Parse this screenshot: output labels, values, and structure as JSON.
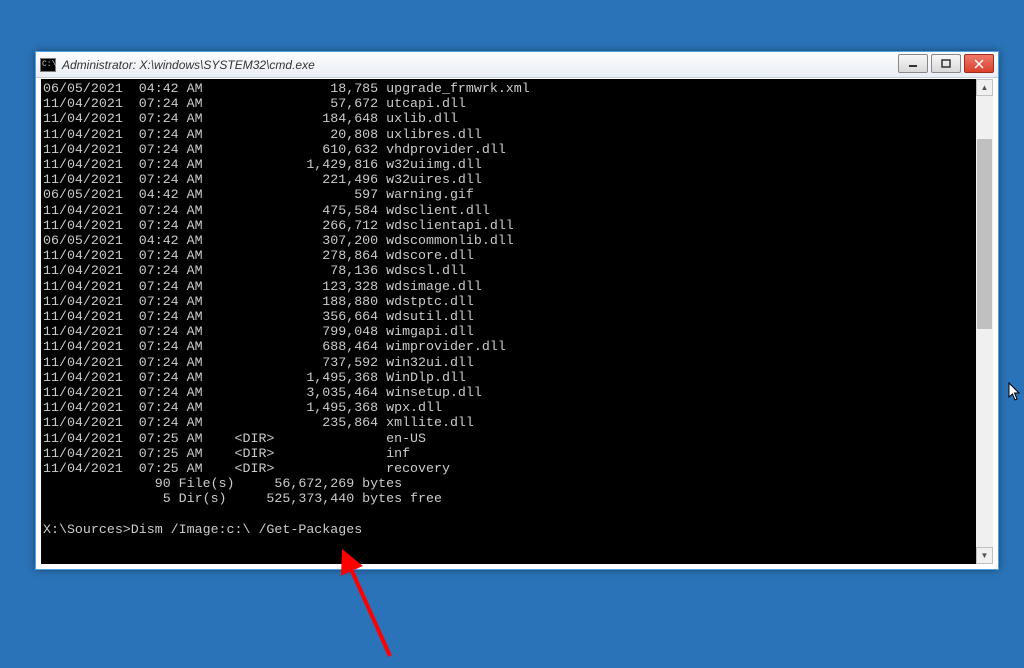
{
  "window": {
    "title": "Administrator: X:\\windows\\SYSTEM32\\cmd.exe",
    "icon_label": "C:\\"
  },
  "listing": [
    {
      "date": "06/05/2021",
      "time": "04:42 AM",
      "dir": "",
      "size": "18,785",
      "name": "upgrade_frmwrk.xml"
    },
    {
      "date": "11/04/2021",
      "time": "07:24 AM",
      "dir": "",
      "size": "57,672",
      "name": "utcapi.dll"
    },
    {
      "date": "11/04/2021",
      "time": "07:24 AM",
      "dir": "",
      "size": "184,648",
      "name": "uxlib.dll"
    },
    {
      "date": "11/04/2021",
      "time": "07:24 AM",
      "dir": "",
      "size": "20,808",
      "name": "uxlibres.dll"
    },
    {
      "date": "11/04/2021",
      "time": "07:24 AM",
      "dir": "",
      "size": "610,632",
      "name": "vhdprovider.dll"
    },
    {
      "date": "11/04/2021",
      "time": "07:24 AM",
      "dir": "",
      "size": "1,429,816",
      "name": "w32uiimg.dll"
    },
    {
      "date": "11/04/2021",
      "time": "07:24 AM",
      "dir": "",
      "size": "221,496",
      "name": "w32uires.dll"
    },
    {
      "date": "06/05/2021",
      "time": "04:42 AM",
      "dir": "",
      "size": "597",
      "name": "warning.gif"
    },
    {
      "date": "11/04/2021",
      "time": "07:24 AM",
      "dir": "",
      "size": "475,584",
      "name": "wdsclient.dll"
    },
    {
      "date": "11/04/2021",
      "time": "07:24 AM",
      "dir": "",
      "size": "266,712",
      "name": "wdsclientapi.dll"
    },
    {
      "date": "06/05/2021",
      "time": "04:42 AM",
      "dir": "",
      "size": "307,200",
      "name": "wdscommonlib.dll"
    },
    {
      "date": "11/04/2021",
      "time": "07:24 AM",
      "dir": "",
      "size": "278,864",
      "name": "wdscore.dll"
    },
    {
      "date": "11/04/2021",
      "time": "07:24 AM",
      "dir": "",
      "size": "78,136",
      "name": "wdscsl.dll"
    },
    {
      "date": "11/04/2021",
      "time": "07:24 AM",
      "dir": "",
      "size": "123,328",
      "name": "wdsimage.dll"
    },
    {
      "date": "11/04/2021",
      "time": "07:24 AM",
      "dir": "",
      "size": "188,880",
      "name": "wdstptc.dll"
    },
    {
      "date": "11/04/2021",
      "time": "07:24 AM",
      "dir": "",
      "size": "356,664",
      "name": "wdsutil.dll"
    },
    {
      "date": "11/04/2021",
      "time": "07:24 AM",
      "dir": "",
      "size": "799,048",
      "name": "wimgapi.dll"
    },
    {
      "date": "11/04/2021",
      "time": "07:24 AM",
      "dir": "",
      "size": "688,464",
      "name": "wimprovider.dll"
    },
    {
      "date": "11/04/2021",
      "time": "07:24 AM",
      "dir": "",
      "size": "737,592",
      "name": "win32ui.dll"
    },
    {
      "date": "11/04/2021",
      "time": "07:24 AM",
      "dir": "",
      "size": "1,495,368",
      "name": "WinDlp.dll"
    },
    {
      "date": "11/04/2021",
      "time": "07:24 AM",
      "dir": "",
      "size": "3,035,464",
      "name": "winsetup.dll"
    },
    {
      "date": "11/04/2021",
      "time": "07:24 AM",
      "dir": "",
      "size": "1,495,368",
      "name": "wpx.dll"
    },
    {
      "date": "11/04/2021",
      "time": "07:24 AM",
      "dir": "",
      "size": "235,864",
      "name": "xmllite.dll"
    },
    {
      "date": "11/04/2021",
      "time": "07:25 AM",
      "dir": "<DIR>",
      "size": "",
      "name": "en-US"
    },
    {
      "date": "11/04/2021",
      "time": "07:25 AM",
      "dir": "<DIR>",
      "size": "",
      "name": "inf"
    },
    {
      "date": "11/04/2021",
      "time": "07:25 AM",
      "dir": "<DIR>",
      "size": "",
      "name": "recovery"
    }
  ],
  "summary": {
    "files_line": "              90 File(s)     56,672,269 bytes",
    "dirs_line": "               5 Dir(s)     525,373,440 bytes free"
  },
  "prompt": {
    "path": "X:\\Sources>",
    "command": "Dism /Image:c:\\ /Get-Packages"
  }
}
